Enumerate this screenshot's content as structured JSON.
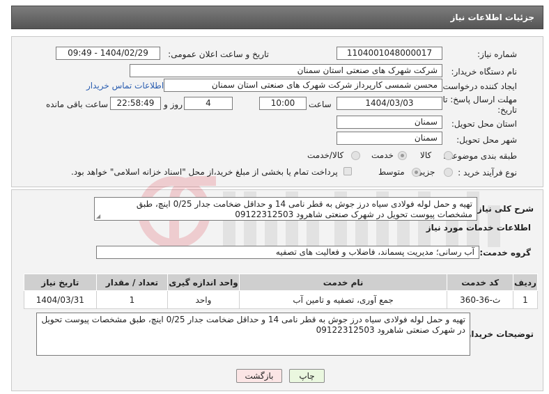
{
  "header": {
    "title": "جزئیات اطلاعات نیاز"
  },
  "form": {
    "need_number_label": "شماره نیاز:",
    "need_number": "1104001048000017",
    "announce_label": "تاریخ و ساعت اعلان عمومی:",
    "announce_value": "1404/02/29 - 09:49",
    "buyer_org_label": "نام دستگاه خریدار:",
    "buyer_org": "شرکت شهرک های صنعتی استان سمنان",
    "creator_label": "ایجاد کننده درخواست:",
    "creator": "محسن شمسی کارپرداز شرکت شهرک های صنعتی استان سمنان",
    "contact_link": "اطلاعات تماس خریدار",
    "deadline_label_1": "مهلت ارسال پاسخ: تا",
    "deadline_label_2": "تاریخ:",
    "deadline_date": "1404/03/03",
    "time_label": "ساعت",
    "deadline_time": "10:00",
    "days_value": "4",
    "days_label": "روز و",
    "remaining_time": "22:58:49",
    "remaining_label": "ساعت باقی مانده",
    "province_label": "استان محل تحویل:",
    "province": "سمنان",
    "city_label": "شهر محل تحویل:",
    "city": "سمنان",
    "category_label": "طبقه بندی موضوعی:",
    "category_options": [
      "کالا",
      "خدمت",
      "کالا/خدمت"
    ],
    "category_selected": "خدمت",
    "process_label": "نوع فرآیند خرید :",
    "process_options": [
      "جزیی",
      "متوسط"
    ],
    "process_selected": "متوسط",
    "payment_note": "پرداخت تمام یا بخشی از مبلغ خرید،از محل \"اسناد خزانه اسلامی\" خواهد بود."
  },
  "details": {
    "summary_label": "شرح کلی نیاز:",
    "summary": "تهیه و حمل لوله فولادی سیاه درز جوش به قطر نامی 14 و حداقل ضخامت جدار 0/25 اینچ، طبق مشخصات پیوست تحویل در شهرک صنعتی شاهرود 09122312503",
    "services_heading": "اطلاعات خدمات مورد نیاز",
    "service_group_label": "گروه خدمت:",
    "service_group": "آب رسانی؛ مدیریت پسماند، فاضلاب و فعالیت های تصفیه",
    "table": {
      "headers": [
        "ردیف",
        "کد خدمت",
        "نام خدمت",
        "واحد اندازه گیری",
        "تعداد / مقدار",
        "تاریخ نیاز"
      ],
      "rows": [
        [
          "1",
          "ث-36-360",
          "جمع آوری، تصفیه و تامین آب",
          "واحد",
          "1",
          "1404/03/31"
        ]
      ]
    },
    "buyer_notes_label": "توضیحات خریدار:",
    "buyer_notes": "تهیه و حمل لوله فولادی سیاه درز جوش به قطر نامی 14 و حداقل ضخامت جدار 0/25 اینچ، طبق مشخصات پیوست تحویل در شهرک صنعتی شاهرود 09122312503"
  },
  "buttons": {
    "print": "چاپ",
    "back": "بازگشت"
  },
  "colors": {
    "header_bg": "#666666",
    "link": "#2a5db0",
    "print_bg": "#eaf7df",
    "back_bg": "#fbe5e5"
  }
}
